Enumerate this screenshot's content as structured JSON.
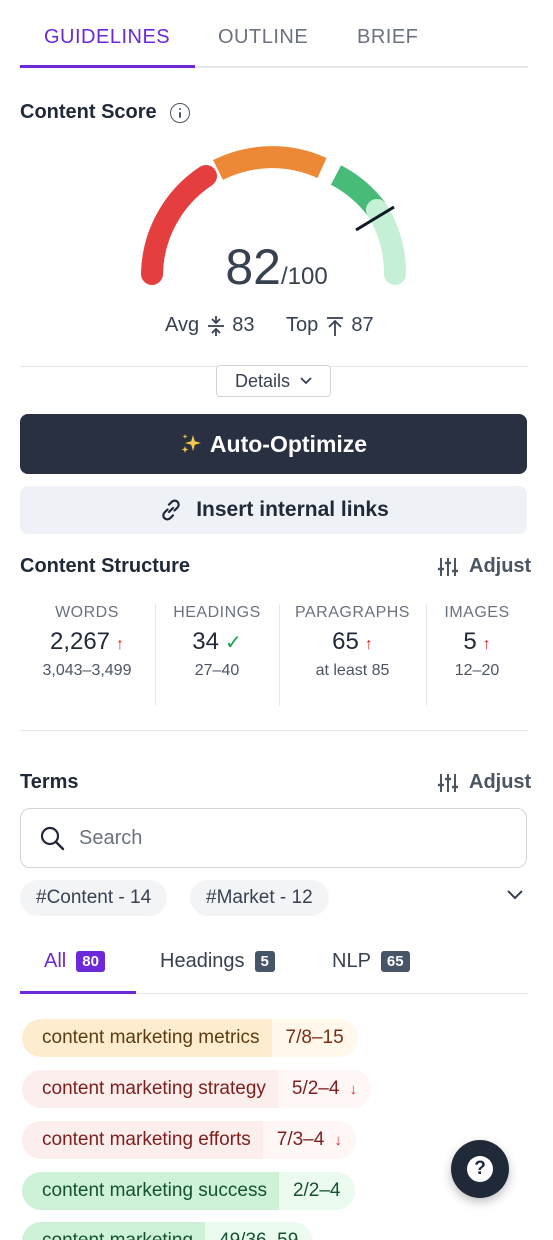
{
  "top_tabs": [
    {
      "label": "GUIDELINES",
      "active": true
    },
    {
      "label": "OUTLINE",
      "active": false
    },
    {
      "label": "BRIEF",
      "active": false
    }
  ],
  "content_score": {
    "title": "Content Score",
    "score": "82",
    "max": "/100",
    "avg_label": "Avg",
    "avg_value": "83",
    "top_label": "Top",
    "top_value": "87",
    "details_label": "Details",
    "gauge_colors": [
      "#e53e3e",
      "#ed8936",
      "#48bb78",
      "#c6f0d5"
    ]
  },
  "actions": {
    "auto_optimize": "Auto-Optimize",
    "auto_optimize_icon": "sparkles-icon",
    "insert_links": "Insert internal links",
    "insert_links_icon": "link-icon"
  },
  "content_structure": {
    "title": "Content Structure",
    "adjust_label": "Adjust",
    "stats": [
      {
        "label": "WORDS",
        "value": "2,267",
        "indicator": "↑",
        "range": "3,043–3,499"
      },
      {
        "label": "HEADINGS",
        "value": "34",
        "indicator": "✓",
        "range": "27–40"
      },
      {
        "label": "PARAGRAPHS",
        "value": "65",
        "indicator": "↑",
        "range": "at least 85"
      },
      {
        "label": "IMAGES",
        "value": "5",
        "indicator": "↑",
        "range": "12–20"
      }
    ]
  },
  "terms": {
    "title": "Terms",
    "adjust_label": "Adjust",
    "search_placeholder": "Search",
    "chips": [
      "#Content - 14",
      "#Market - 12"
    ],
    "tabs": [
      {
        "label": "All",
        "count": "80",
        "active": true
      },
      {
        "label": "Headings",
        "count": "5",
        "active": false
      },
      {
        "label": "NLP",
        "count": "65",
        "active": false
      }
    ],
    "items": [
      {
        "name": "content marketing metrics",
        "count": "7/8–15",
        "status": "orange",
        "indicator": ""
      },
      {
        "name": "content marketing strategy",
        "count": "5/2–4",
        "status": "red",
        "indicator": "↓"
      },
      {
        "name": "content marketing efforts",
        "count": "7/3–4",
        "status": "red",
        "indicator": "↓"
      },
      {
        "name": "content marketing success",
        "count": "2/2–4",
        "status": "green",
        "indicator": ""
      },
      {
        "name": "content marketing",
        "count": "49/36–59",
        "status": "green",
        "indicator": ""
      }
    ]
  },
  "help_button": {
    "label": "?"
  }
}
